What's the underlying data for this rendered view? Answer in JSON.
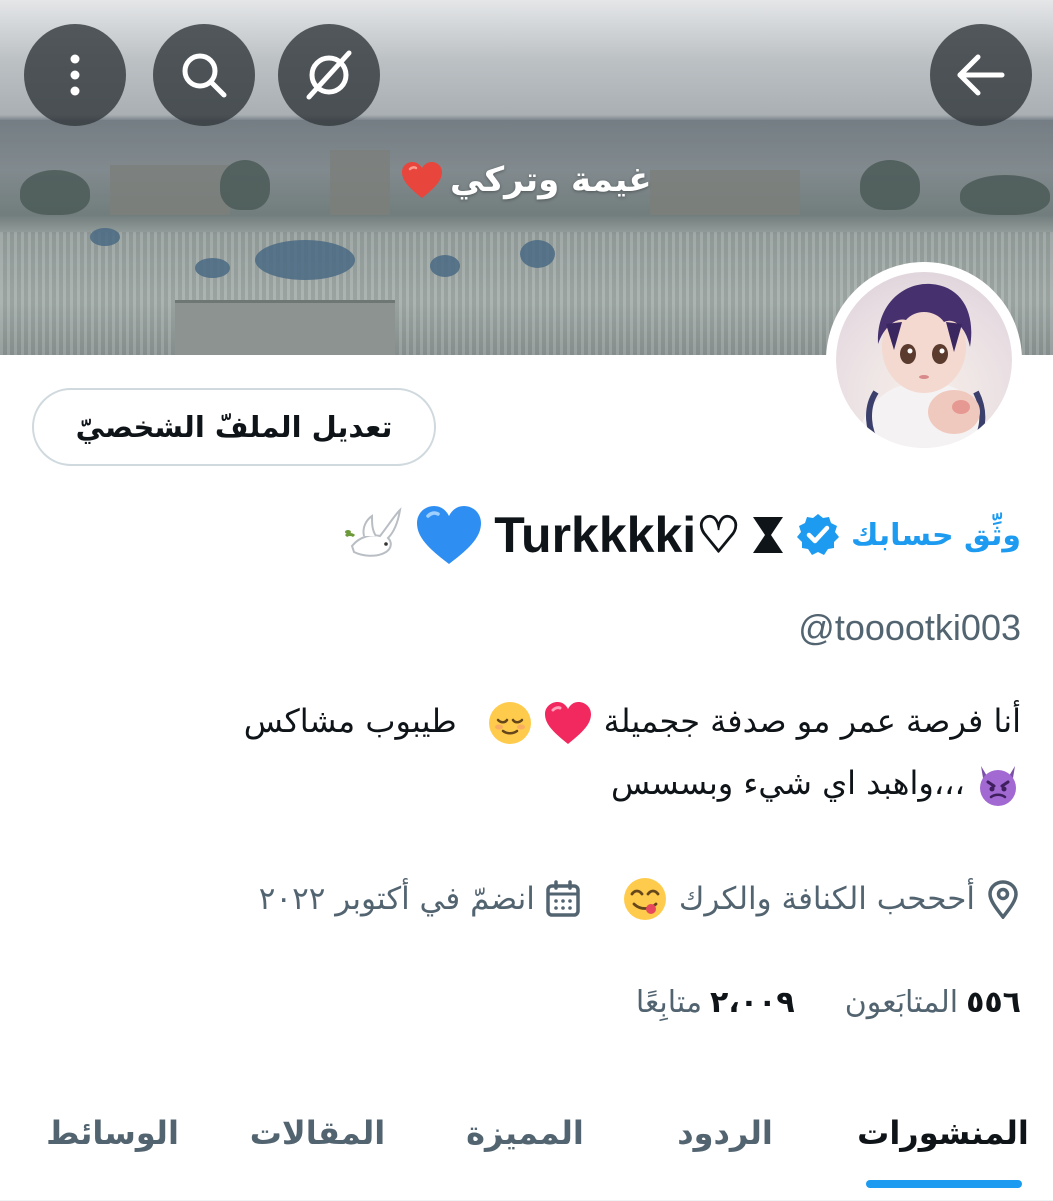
{
  "banner": {
    "caption": "غيمة وتركي",
    "icons": [
      "back-arrow-icon",
      "hide-icon",
      "search-icon",
      "more-icon"
    ]
  },
  "profile": {
    "edit_button": "تعديل الملفّ الشخصيّ",
    "verify_link": "وثِّق حسابك",
    "display_name": "Turkkkki♡",
    "handle": "@tooootki003",
    "bio_line1": "أنا فرصة عمر مو صدفة ججميلة",
    "bio_line1_b": "طيبوب مشاكس",
    "bio_line2": "،،،واهبد اي شيء وبسسس",
    "location": "أحححب الكنافة والكرك",
    "joined": "انضمّ في أكتوبر ٢٠٢٢",
    "followers_count": "٥٥٦",
    "followers_label": "المتابَعون",
    "following_count": "٢،٠٠٩",
    "following_label": "متابِعًا"
  },
  "tabs": [
    {
      "label": "المنشورات",
      "active": true
    },
    {
      "label": "الردود",
      "active": false
    },
    {
      "label": "المميزة",
      "active": false
    },
    {
      "label": "المقالات",
      "active": false
    },
    {
      "label": "الوسائط",
      "active": false
    }
  ],
  "colors": {
    "accent": "#1d9bf0",
    "secondary_text": "#536471",
    "primary_text": "#0f1419"
  }
}
